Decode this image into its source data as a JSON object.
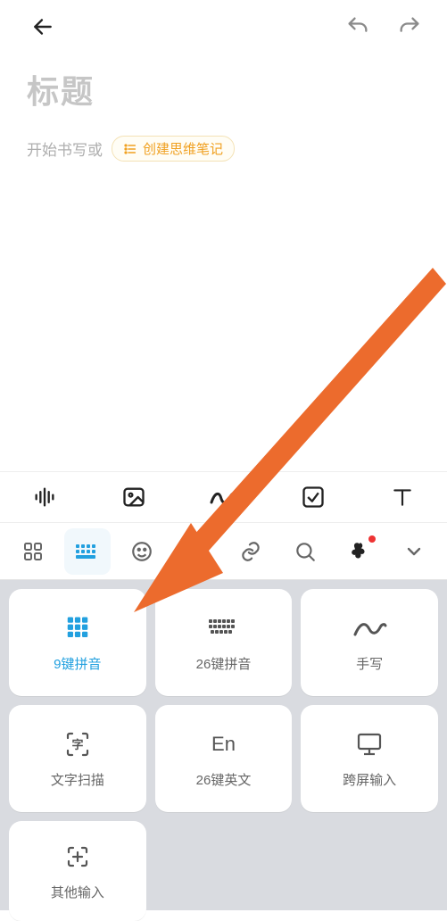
{
  "editor": {
    "title_placeholder": "标题",
    "body_placeholder": "开始书写或",
    "mindnote_label": "创建思维笔记"
  },
  "app_toolbar": {
    "items": [
      "voice",
      "image",
      "scribble",
      "checkbox",
      "text"
    ]
  },
  "kb_header": {
    "items": [
      "grid-apps",
      "keyboard",
      "emoji",
      "sticker",
      "link",
      "search",
      "clover",
      "collapse"
    ],
    "active_index": 1,
    "badge_index": 6
  },
  "input_methods": {
    "tiles": [
      {
        "id": "pinyin-9",
        "label": "9键拼音",
        "selected": true
      },
      {
        "id": "pinyin-26",
        "label": "26键拼音",
        "selected": false
      },
      {
        "id": "handwrite",
        "label": "手写",
        "selected": false
      },
      {
        "id": "ocr",
        "label": "文字扫描",
        "selected": false
      },
      {
        "id": "english-26",
        "label": "26键英文",
        "icon_text": "En",
        "selected": false
      },
      {
        "id": "cross-screen",
        "label": "跨屏输入",
        "selected": false
      },
      {
        "id": "other",
        "label": "其他输入",
        "selected": false
      }
    ]
  },
  "annotation": {
    "type": "arrow",
    "color": "#ec6b2d"
  }
}
